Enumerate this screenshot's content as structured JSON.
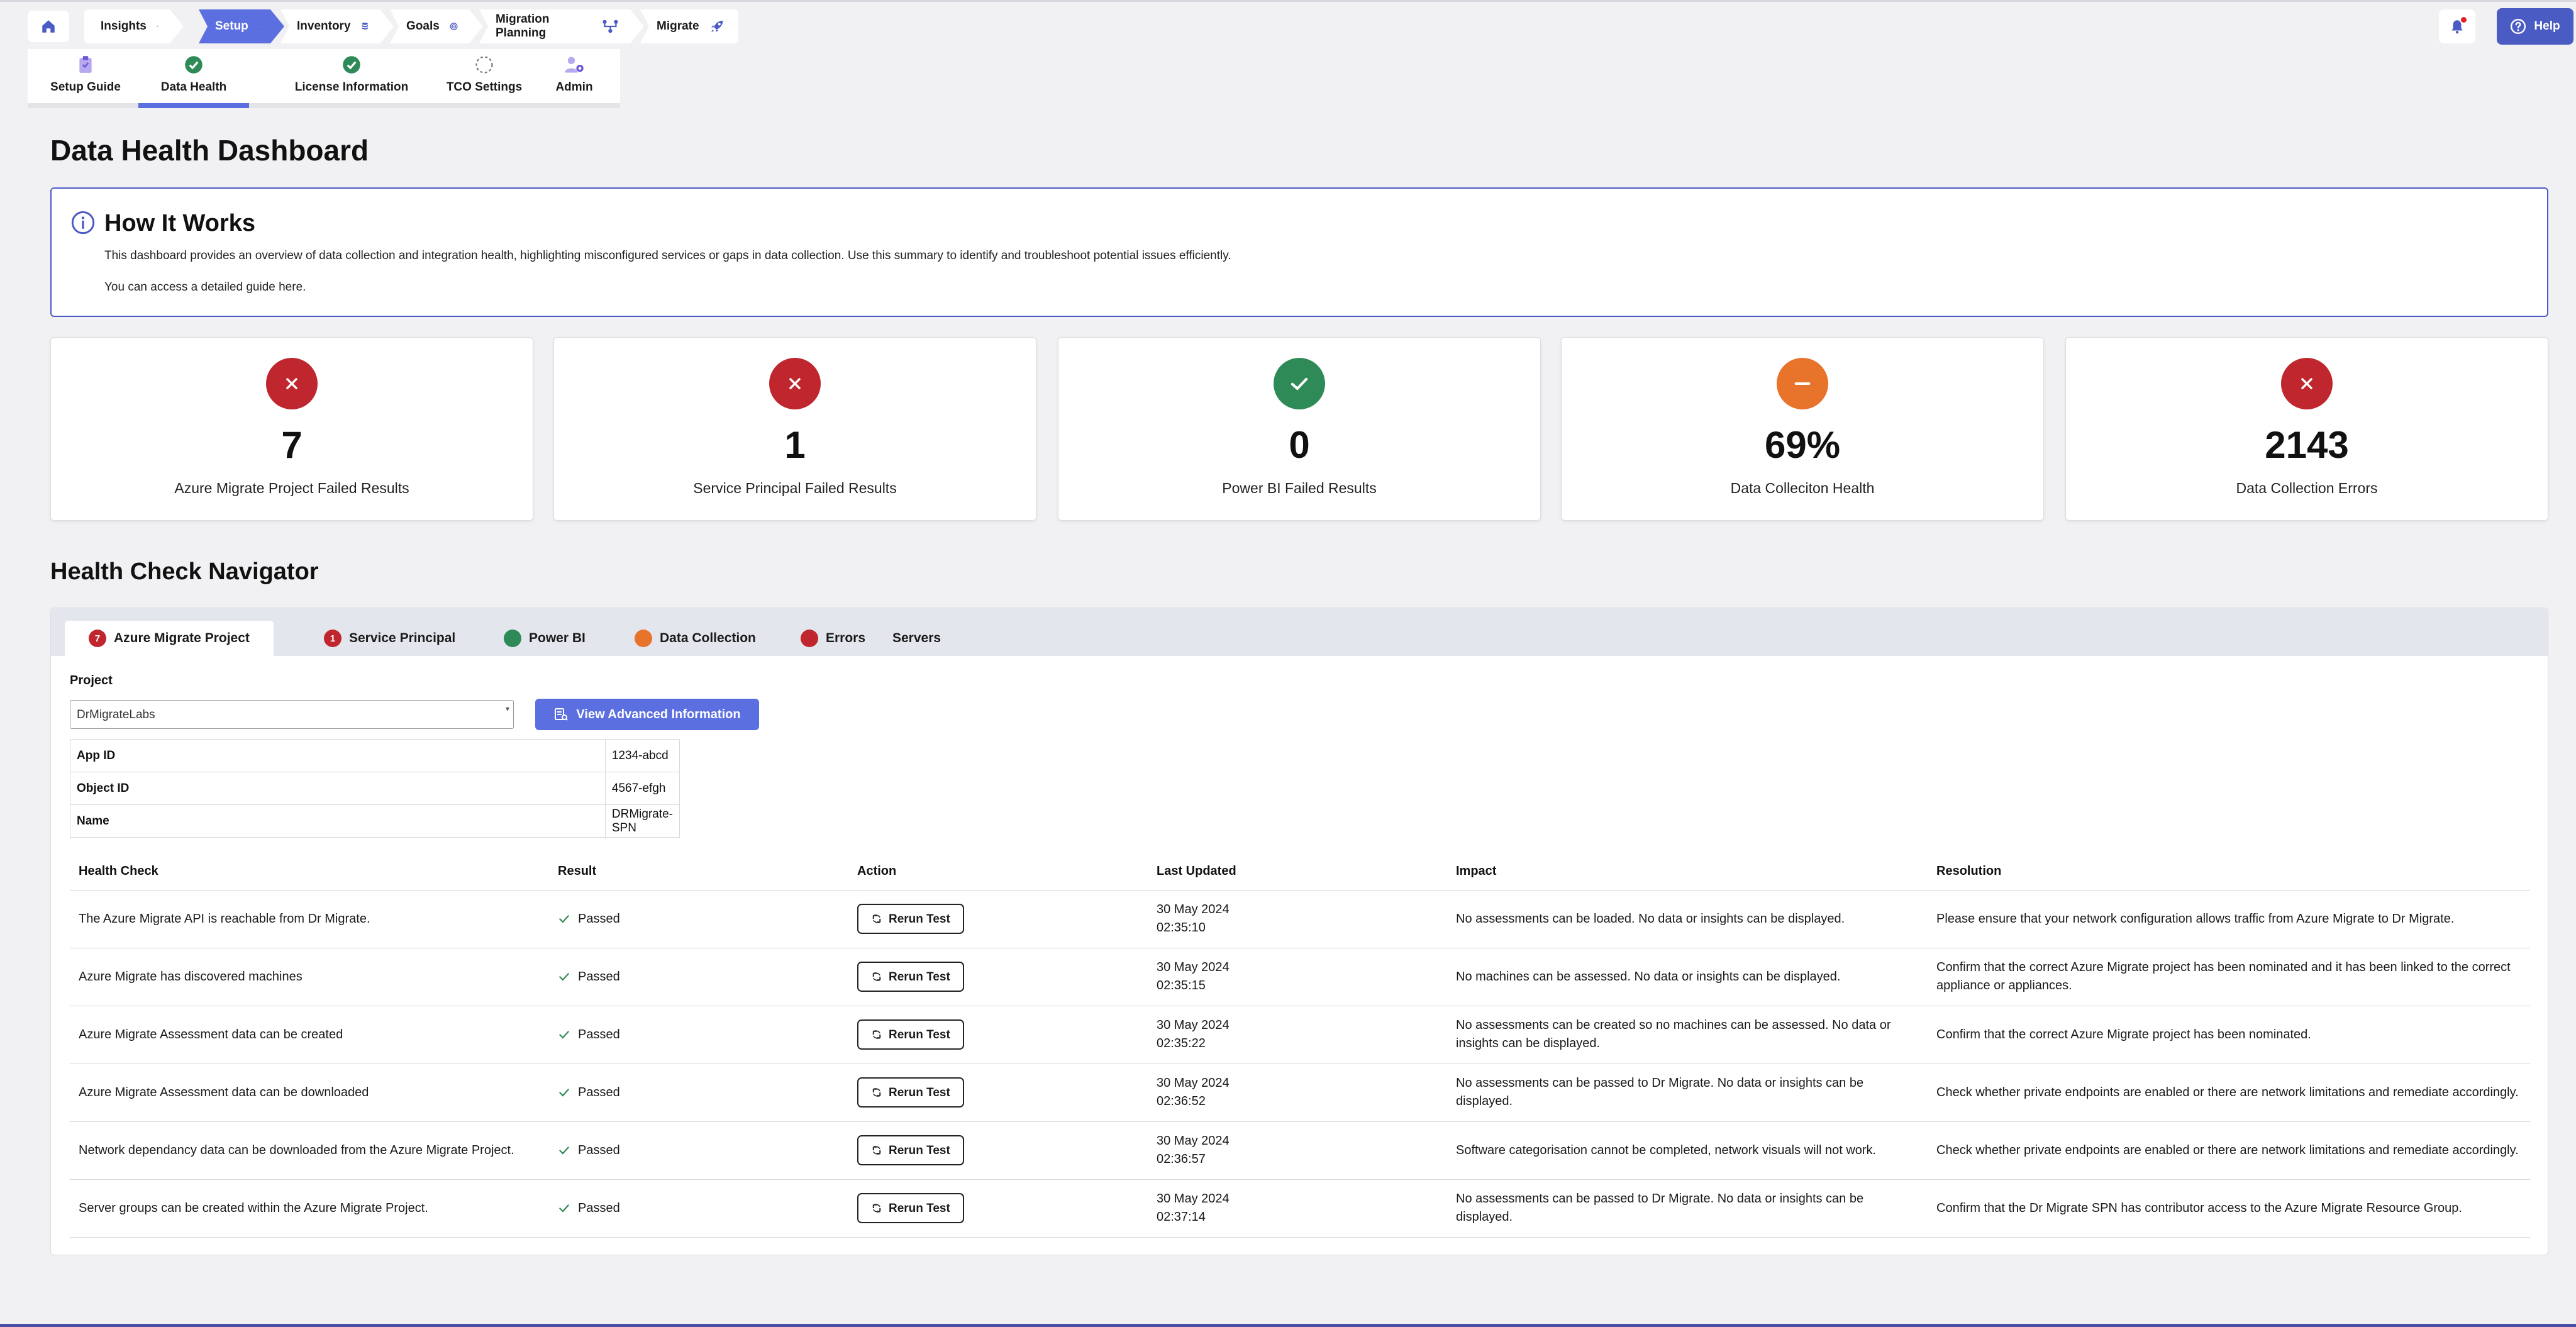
{
  "topnav": {
    "crumbs": [
      {
        "label": "Insights",
        "icon": "search-icon"
      },
      {
        "label": "Setup",
        "icon": "gear-icon"
      },
      {
        "label": "Inventory",
        "icon": "database-icon"
      },
      {
        "label": "Goals",
        "icon": "target-icon"
      },
      {
        "label": "Migration Planning",
        "icon": "flow-icon"
      },
      {
        "label": "Migrate",
        "icon": "rocket-icon"
      }
    ],
    "help_label": "Help"
  },
  "subtabs": [
    "Setup Guide",
    "Data Health",
    "License Information",
    "TCO Settings",
    "Admin"
  ],
  "page_title": "Data Health Dashboard",
  "how": {
    "title": "How It Works",
    "text1": "This dashboard provides an overview of data collection and integration health, highlighting misconfigured services or gaps in data collection. Use this summary to identify and troubleshoot potential issues efficiently.",
    "text2": "You can access a detailed guide here."
  },
  "cards": [
    {
      "value": "7",
      "label": "Azure Migrate Project Failed Results",
      "status": "error",
      "color": "#c0262d"
    },
    {
      "value": "1",
      "label": "Service Principal Failed Results",
      "status": "error",
      "color": "#c0262d"
    },
    {
      "value": "0",
      "label": "Power BI Failed Results",
      "status": "success",
      "color": "#2e8a57"
    },
    {
      "value": "69%",
      "label": "Data Colleciton Health",
      "status": "warning",
      "color": "#e8732b"
    },
    {
      "value": "2143",
      "label": "Data Collection Errors",
      "status": "error",
      "color": "#c0262d"
    }
  ],
  "navigator": {
    "title": "Health Check Navigator",
    "tabs": [
      {
        "label": "Azure Migrate Project",
        "badge": "7",
        "color": "#c0262d"
      },
      {
        "label": "Service Principal",
        "badge": "1",
        "color": "#c0262d"
      },
      {
        "label": "Power BI",
        "badge": "",
        "color": "#2e8a57"
      },
      {
        "label": "Data Collection",
        "badge": "",
        "color": "#e8732b"
      },
      {
        "label": "Errors",
        "badge": "",
        "color": "#c0262d"
      },
      {
        "label": "Servers",
        "badge": "",
        "color": ""
      }
    ],
    "project_label": "Project",
    "project_value": "DrMigrateLabs",
    "adv_button": "View Advanced Information",
    "info": [
      {
        "key": "App ID",
        "value": "1234-abcd"
      },
      {
        "key": "Object ID",
        "value": "4567-efgh"
      },
      {
        "key": "Name",
        "value": "DRMigrate-SPN"
      }
    ],
    "columns": [
      "Health Check",
      "Result",
      "Action",
      "Last Updated",
      "Impact",
      "Resolution"
    ],
    "rows": [
      {
        "check": "The Azure Migrate API is reachable from Dr Migrate.",
        "result": "Passed",
        "action": "Rerun Test",
        "date": "30 May 2024",
        "time": "02:35:10",
        "impact": "No assessments can be loaded. No data or insights can be displayed.",
        "resolution": "Please ensure that your network configuration allows traffic from Azure Migrate to Dr Migrate."
      },
      {
        "check": "Azure Migrate has discovered machines",
        "result": "Passed",
        "action": "Rerun Test",
        "date": "30 May 2024",
        "time": "02:35:15",
        "impact": "No machines can be assessed. No data or insights can be displayed.",
        "resolution": "Confirm that the correct Azure Migrate project has been nominated and it has been linked to the correct appliance or appliances."
      },
      {
        "check": "Azure Migrate Assessment data can be created",
        "result": "Passed",
        "action": "Rerun Test",
        "date": "30 May 2024",
        "time": "02:35:22",
        "impact": "No assessments can be created so no machines can be assessed. No data or insights can be displayed.",
        "resolution": "Confirm that the correct Azure Migrate project has been nominated."
      },
      {
        "check": "Azure Migrate Assessment data can be downloaded",
        "result": "Passed",
        "action": "Rerun Test",
        "date": "30 May 2024",
        "time": "02:36:52",
        "impact": "No assessments can be passed to Dr Migrate. No data or insights can be displayed.",
        "resolution": "Check whether private endpoints are enabled or there are network limitations and remediate accordingly."
      },
      {
        "check": "Network dependancy data can be downloaded from the Azure Migrate Project.",
        "result": "Passed",
        "action": "Rerun Test",
        "date": "30 May 2024",
        "time": "02:36:57",
        "impact": "Software categorisation cannot be completed, network visuals will not work.",
        "resolution": "Check whether private endpoints are enabled or there are network limitations and remediate accordingly."
      },
      {
        "check": "Server groups can be created within the Azure Migrate Project.",
        "result": "Passed",
        "action": "Rerun Test",
        "date": "30 May 2024",
        "time": "02:37:14",
        "impact": "No assessments can be passed to Dr Migrate. No data or insights can be displayed.",
        "resolution": "Confirm that the Dr Migrate SPN has contributor access to the Azure Migrate Resource Group."
      }
    ]
  },
  "colors": {
    "accent": "#5b6fe0",
    "help": "#4a5bc4",
    "error": "#c0262d",
    "success": "#2e8a57",
    "warning": "#e8732b"
  }
}
